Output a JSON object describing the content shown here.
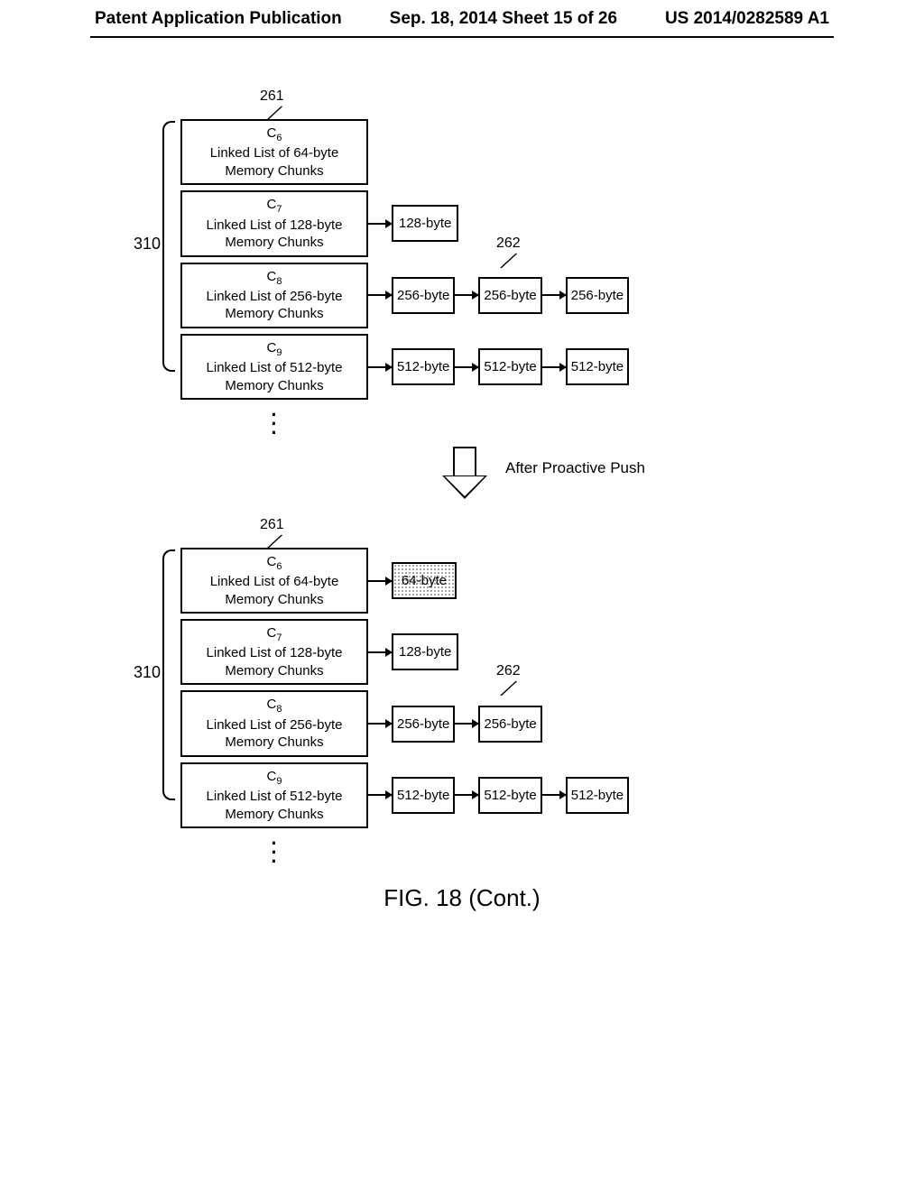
{
  "header": {
    "left": "Patent Application Publication",
    "middle": "Sep. 18, 2014  Sheet 15 of 26",
    "right": "US 2014/0282589 A1"
  },
  "ref": {
    "r261a": "261",
    "r261b": "261",
    "r262a": "262",
    "r262b": "262",
    "r310a": "310",
    "r310b": "310"
  },
  "top": {
    "c6": {
      "sub": "6",
      "line2": "Linked List of 64-byte",
      "line3": "Memory Chunks"
    },
    "c7": {
      "sub": "7",
      "line2": "Linked List of 128-byte",
      "line3": "Memory Chunks",
      "ch1": "128-byte"
    },
    "c8": {
      "sub": "8",
      "line2": "Linked List of 256-byte",
      "line3": "Memory Chunks",
      "ch1": "256-byte",
      "ch2": "256-byte",
      "ch3": "256-byte"
    },
    "c9": {
      "sub": "9",
      "line2": "Linked List of 512-byte",
      "line3": "Memory Chunks",
      "ch1": "512-byte",
      "ch2": "512-byte",
      "ch3": "512-byte"
    }
  },
  "push_label": "After Proactive Push",
  "bottom": {
    "c6": {
      "sub": "6",
      "line2": "Linked List of 64-byte",
      "line3": "Memory Chunks",
      "ch1": "64-byte"
    },
    "c7": {
      "sub": "7",
      "line2": "Linked List of 128-byte",
      "line3": "Memory Chunks",
      "ch1": "128-byte"
    },
    "c8": {
      "sub": "8",
      "line2": "Linked List of 256-byte",
      "line3": "Memory Chunks",
      "ch1": "256-byte",
      "ch2": "256-byte"
    },
    "c9": {
      "sub": "9",
      "line2": "Linked List of 512-byte",
      "line3": "Memory Chunks",
      "ch1": "512-byte",
      "ch2": "512-byte",
      "ch3": "512-byte"
    }
  },
  "caption": "FIG. 18 (Cont.)"
}
